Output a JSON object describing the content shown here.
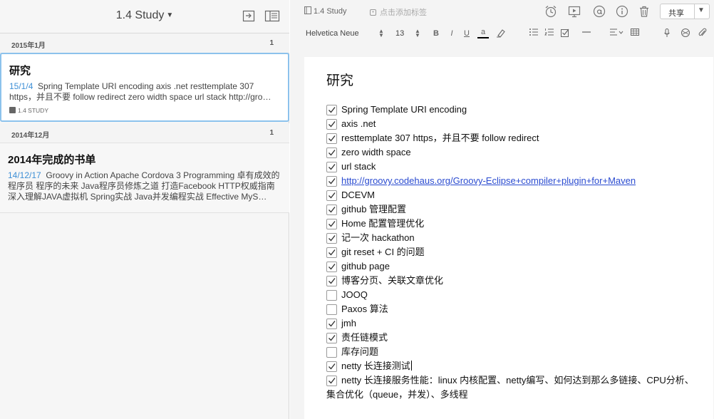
{
  "notebook_list": {
    "title": "1.4 Study",
    "months": [
      {
        "label": "2015年1月",
        "count": "1"
      },
      {
        "label": "2014年12月",
        "count": "1"
      }
    ],
    "notes": [
      {
        "title": "研究",
        "date": "15/1/4",
        "snippet": "Spring Template URI encoding axis .net resttemplate 307 https，并且不要 follow redirect zero width space url stack http://gro…",
        "notebook": "1.4 STUDY"
      },
      {
        "title": "2014年完成的书单",
        "date": "14/12/17",
        "snippet": "Groovy in Action Apache Cordova 3 Programming 卓有成效的程序员 程序的未来 Java程序员修炼之道 打造Facebook HTTP权威指南 深入理解JAVA虚拟机 Spring实战 Java并发编程实战 Effective MyS…"
      }
    ]
  },
  "note_header": {
    "notebook": "1.4 Study",
    "tags_placeholder": "点击添加标签",
    "share_label": "共享"
  },
  "format_bar": {
    "font": "Helvetica Neue",
    "size": "13",
    "bold": "B",
    "italic": "I",
    "underline": "U",
    "text_color": "a"
  },
  "note": {
    "title": "研究",
    "checklist": [
      {
        "text": "Spring Template URI encoding",
        "checked": true
      },
      {
        "text": "axis .net",
        "checked": true
      },
      {
        "text": "resttemplate 307 https，并且不要 follow redirect",
        "checked": true
      },
      {
        "text": "zero width space",
        "checked": true
      },
      {
        "text": "url stack",
        "checked": true
      },
      {
        "text": "http://groovy.codehaus.org/Groovy-Eclipse+compiler+plugin+for+Maven",
        "checked": true,
        "link": true
      },
      {
        "text": "DCEVM",
        "checked": true
      },
      {
        "text": "github 管理配置",
        "checked": true
      },
      {
        "text": "Home 配置管理优化",
        "checked": true
      },
      {
        "text": "记一次 hackathon",
        "checked": true
      },
      {
        "text": "git reset + CI 的问题",
        "checked": true
      },
      {
        "text": "github page",
        "checked": true
      },
      {
        "text": "博客分页、关联文章优化",
        "checked": true
      },
      {
        "text": "JOOQ",
        "checked": false
      },
      {
        "text": "Paxos 算法",
        "checked": false
      },
      {
        "text": "jmh",
        "checked": true
      },
      {
        "text": "责任链模式",
        "checked": true
      },
      {
        "text": "库存问题",
        "checked": false
      },
      {
        "text": "netty 长连接测试",
        "checked": true,
        "caret": true
      },
      {
        "text": "netty 长连接服务性能：linux 内核配置、netty编写、如何达到那么多链接、CPU分析、集合优化（queue，并发）、多线程",
        "checked": true,
        "wrap": true
      }
    ]
  },
  "colors": {
    "accent": "#3d8fd6",
    "selection_border": "#8cc2ec",
    "link": "#2a4bd0"
  }
}
